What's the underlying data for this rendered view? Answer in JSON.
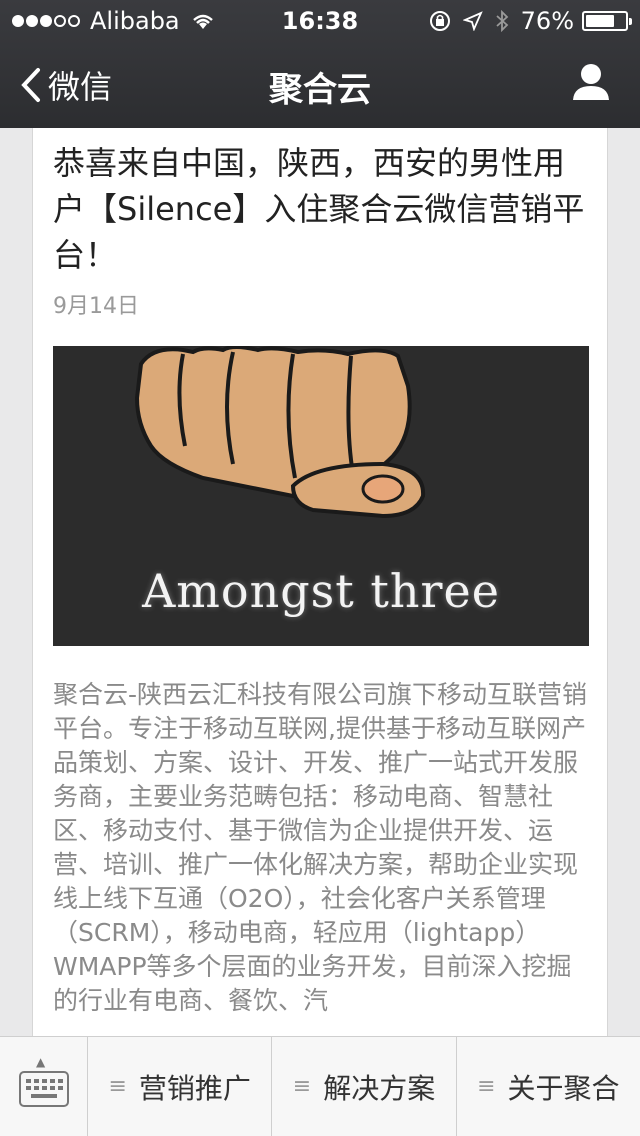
{
  "status_bar": {
    "carrier": "Alibaba",
    "time": "16:38",
    "battery": "76%",
    "battery_level": 0.76
  },
  "nav": {
    "back_label": "微信",
    "title": "聚合云"
  },
  "article": {
    "title": "恭喜来自中国，陕西，西安的男性用户【Silence】入住聚合云微信营销平台！",
    "date": "9月14日",
    "image_caption": "Amongst three",
    "body": "聚合云-陕西云汇科技有限公司旗下移动互联营销平台。专注于移动互联网,提供基于移动互联网产品策划、方案、设计、开发、推广一站式开发服务商，主要业务范畴包括：移动电商、智慧社区、移动支付、基于微信为企业提供开发、运营、培训、推广一体化解决方案，帮助企业实现线上线下互通（O2O），社会化客户关系管理（SCRM），移动电商，轻应用（lightapp）WMAPP等多个层面的业务开发，目前深入挖掘的行业有电商、餐饮、汽"
  },
  "menu": {
    "items": [
      {
        "label": "营销推广"
      },
      {
        "label": "解决方案"
      },
      {
        "label": "关于聚合"
      }
    ]
  },
  "colors": {
    "header_bg": "#2f3033",
    "page_bg": "#e9e9ea",
    "body_text": "#8a8a8a"
  }
}
